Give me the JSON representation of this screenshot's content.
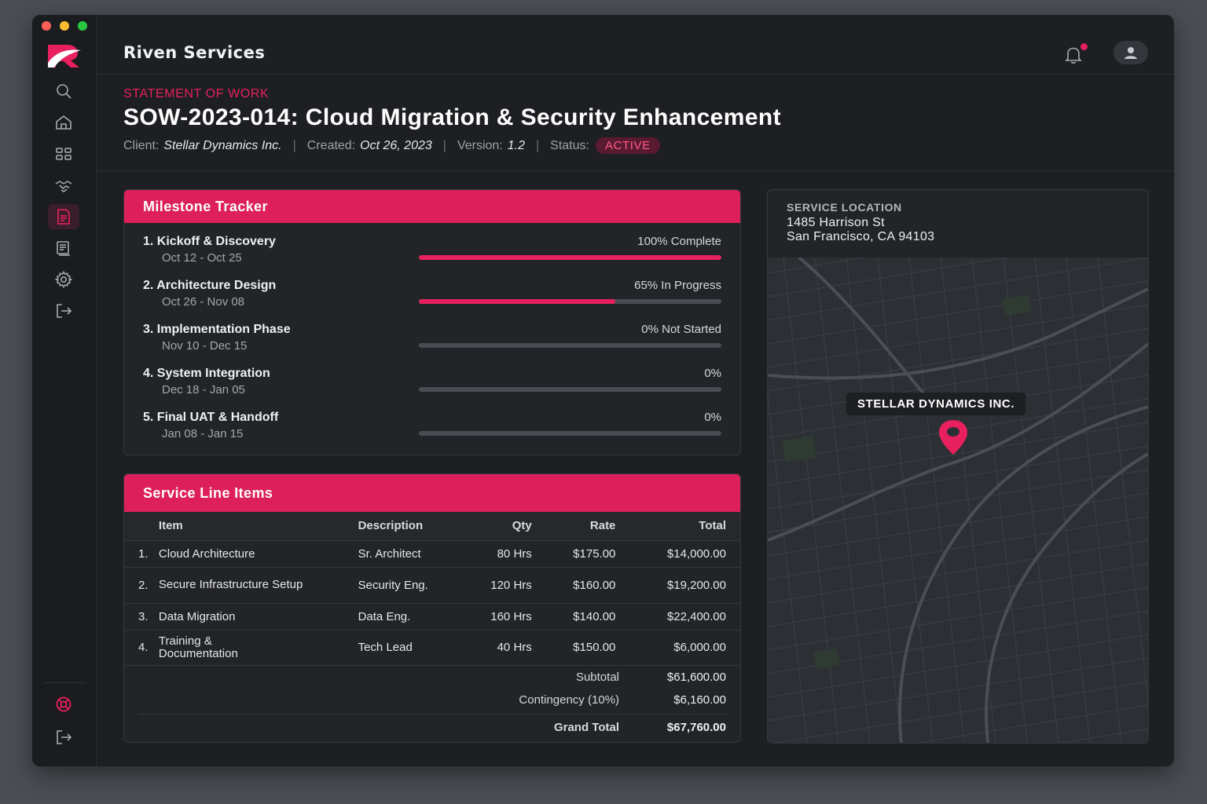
{
  "app": {
    "brand": "Riven Services"
  },
  "header": {
    "eyebrow": "STATEMENT OF WORK",
    "title": "SOW-2023-014: Cloud Migration & Security Enhancement",
    "client_label": "Client:",
    "client": "Stellar Dynamics Inc.",
    "created_label": "Created:",
    "created": "Oct 26, 2023",
    "version_label": "Version:",
    "version": "1.2",
    "status_label": "Status:",
    "status": "ACTIVE"
  },
  "sidebar": {
    "items": [
      {
        "icon": "search-icon"
      },
      {
        "icon": "home-icon"
      },
      {
        "icon": "grid-icon"
      },
      {
        "icon": "handshake-icon"
      },
      {
        "icon": "document-icon",
        "active": true
      },
      {
        "icon": "invoice-icon"
      },
      {
        "icon": "settings-icon"
      },
      {
        "icon": "logout-icon"
      }
    ],
    "bottom": [
      {
        "icon": "help-icon"
      },
      {
        "icon": "signout-icon"
      }
    ]
  },
  "milestones": {
    "title": "Milestone Tracker",
    "items": [
      {
        "title": "1. Kickoff & Discovery",
        "dates": "Oct 12 - Oct 25",
        "status": "100% Complete",
        "progress": 100
      },
      {
        "title": "2. Architecture Design",
        "dates": "Oct 26 - Nov 08",
        "status": "65% In Progress",
        "progress": 65
      },
      {
        "title": "3. Implementation Phase",
        "dates": "Nov 10 - Dec 15",
        "status": "0% Not Started",
        "progress": 0
      },
      {
        "title": "4. System Integration",
        "dates": "Dec 18 - Jan 05",
        "status": "0%",
        "progress": 0
      },
      {
        "title": "5. Final UAT & Handoff",
        "dates": "Jan 08 - Jan 15",
        "status": "0%",
        "progress": 0
      }
    ]
  },
  "line_items": {
    "title": "Service Line Items",
    "columns": {
      "item": "Item",
      "description": "Description",
      "qty": "Qty",
      "rate": "Rate",
      "total": "Total"
    },
    "rows": [
      {
        "num": "1.",
        "item": "Cloud Architecture",
        "description": "Sr. Architect",
        "qty": "80 Hrs",
        "rate": "$175.00",
        "total": "$14,000.00"
      },
      {
        "num": "2.",
        "item": "Secure Infrastructure Setup",
        "description": "Security Eng.",
        "qty": "120 Hrs",
        "rate": "$160.00",
        "total": "$19,200.00"
      },
      {
        "num": "3.",
        "item": "Data Migration",
        "description": "Data Eng.",
        "qty": "160 Hrs",
        "rate": "$140.00",
        "total": "$22,400.00"
      },
      {
        "num": "4.",
        "item": "Training & Documentation",
        "description": "Tech Lead",
        "qty": "40 Hrs",
        "rate": "$150.00",
        "total": "$6,000.00"
      }
    ],
    "subtotal_label": "Subtotal",
    "subtotal": "$61,600.00",
    "contingency_label": "Contingency (10%)",
    "contingency": "$6,160.00",
    "grand_total_label": "Grand Total",
    "grand_total": "$67,760.00"
  },
  "location": {
    "label": "SERVICE LOCATION",
    "street": "1485 Harrison St",
    "city": "San Francisco, CA 94103",
    "map_callout": "STELLAR DYNAMICS INC."
  },
  "colors": {
    "accent": "#dd1f5b",
    "background": "#1d1f22",
    "card": "#222428"
  }
}
